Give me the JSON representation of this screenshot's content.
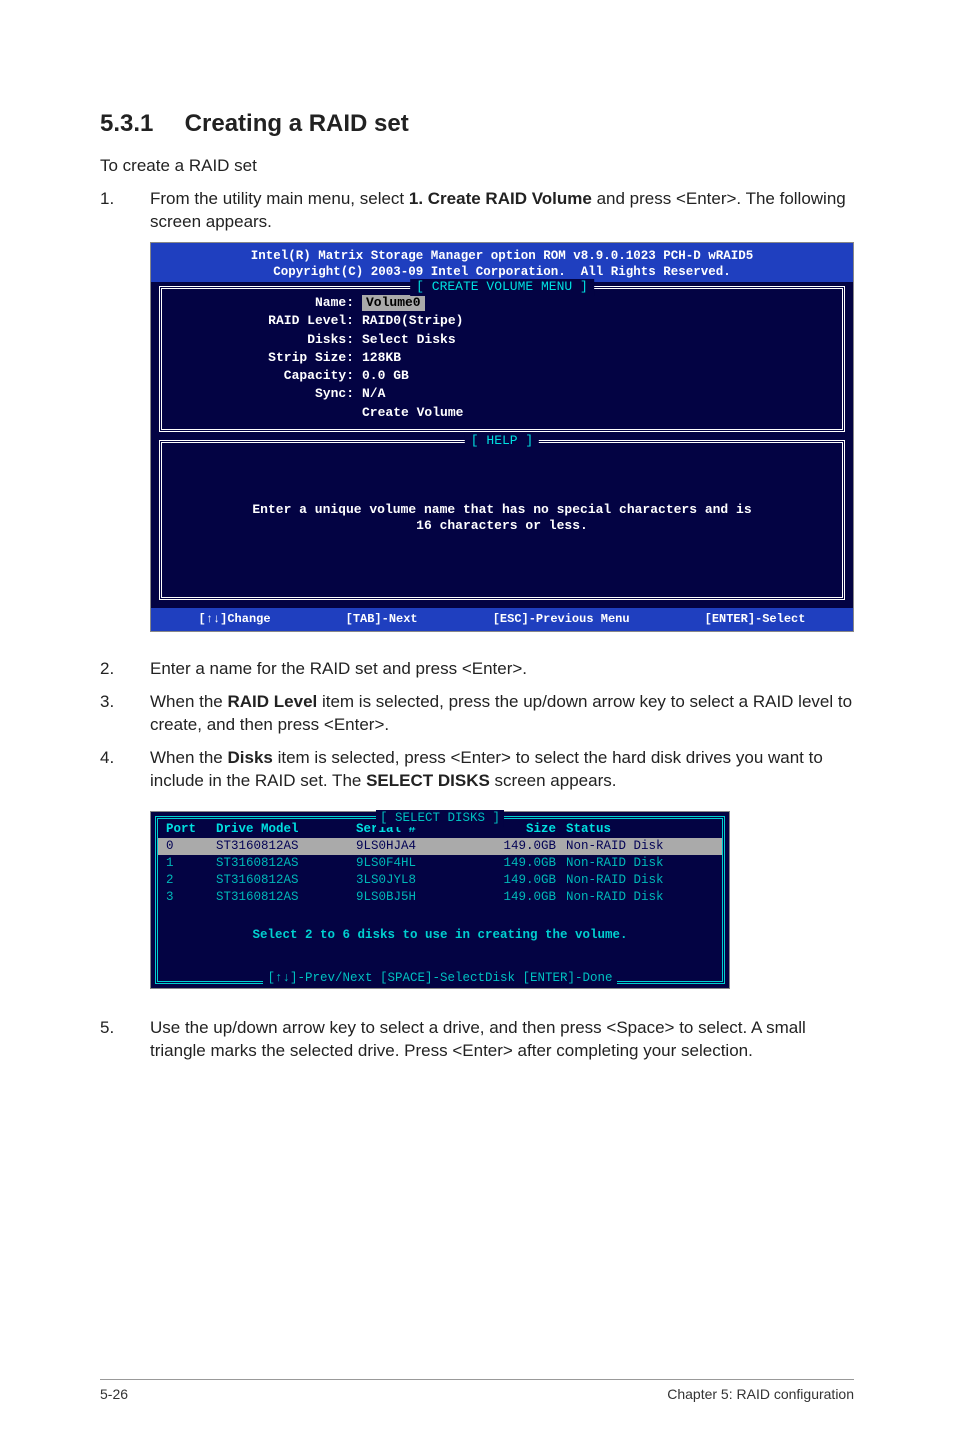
{
  "section": {
    "number": "5.3.1",
    "title": "Creating a RAID set"
  },
  "intro": "To create a RAID set",
  "steps": {
    "s1": {
      "num": "1.",
      "pre": "From the utility main menu, select ",
      "bold": "1. Create RAID Volume",
      "post": " and press <Enter>. The following screen appears."
    },
    "s2": {
      "num": "2.",
      "text": "Enter a name for the RAID set and press <Enter>."
    },
    "s3": {
      "num": "3.",
      "pre": "When the ",
      "bold": "RAID Level",
      "post": " item is selected, press the up/down arrow key to select a RAID level to create, and then press <Enter>."
    },
    "s4": {
      "num": "4.",
      "pre": "When the ",
      "bold1": "Disks",
      "mid": " item is selected, press <Enter> to select the hard disk drives you want to include in the RAID set. The ",
      "bold2": "SELECT DISKS",
      "post": " screen appears."
    },
    "s5": {
      "num": "5.",
      "text": "Use the up/down arrow key to select a drive, and then press <Space> to select. A small triangle marks the selected drive. Press <Enter> after completing your selection."
    }
  },
  "bios1": {
    "header1": "Intel(R) Matrix Storage Manager option ROM v8.9.0.1023 PCH-D wRAID5",
    "header2": "Copyright(C) 2003-09 Intel Corporation.  All Rights Reserved.",
    "menu_title": "[ CREATE VOLUME MENU ]",
    "fields": {
      "name_k": "Name:",
      "name_v": "Volume0",
      "level_k": "RAID Level:",
      "level_v": "RAID0(Stripe)",
      "disks_k": "Disks:",
      "disks_v": "Select Disks",
      "strip_k": "Strip Size:",
      "strip_v": " 128KB",
      "cap_k": "Capacity:",
      "cap_v": "0.0   GB",
      "sync_k": "Sync:",
      "sync_v": "N/A",
      "create_k": "",
      "create_v": "Create Volume"
    },
    "help_title": "[ HELP ]",
    "help1": "Enter a unique volume name that has no special characters and is",
    "help2": "16 characters or less.",
    "footer": {
      "a": "[↑↓]Change",
      "b": "[TAB]-Next",
      "c": "[ESC]-Previous Menu",
      "d": "[ENTER]-Select"
    }
  },
  "bios2": {
    "title": "[ SELECT DISKS ]",
    "head": {
      "c1": "Port",
      "c2": "Drive Model",
      "c3": "Serial #",
      "c4": "Size",
      "c5": "Status"
    },
    "rows": [
      {
        "c1": "0",
        "c2": "ST3160812AS",
        "c3": "9LS0HJA4",
        "c4": "149.0GB",
        "c5": "Non-RAID Disk"
      },
      {
        "c1": "1",
        "c2": "ST3160812AS",
        "c3": "9LS0F4HL",
        "c4": "149.0GB",
        "c5": "Non-RAID Disk"
      },
      {
        "c1": "2",
        "c2": "ST3160812AS",
        "c3": "3LS0JYL8",
        "c4": "149.0GB",
        "c5": "Non-RAID Disk"
      },
      {
        "c1": "3",
        "c2": "ST3160812AS",
        "c3": "9LS0BJ5H",
        "c4": "149.0GB",
        "c5": "Non-RAID Disk"
      }
    ],
    "msg": "Select 2 to 6 disks to use in creating the volume.",
    "keyhint": "[↑↓]-Prev/Next [SPACE]-SelectDisk [ENTER]-Done"
  },
  "footer": {
    "left": "5-26",
    "right": "Chapter 5: RAID configuration"
  }
}
